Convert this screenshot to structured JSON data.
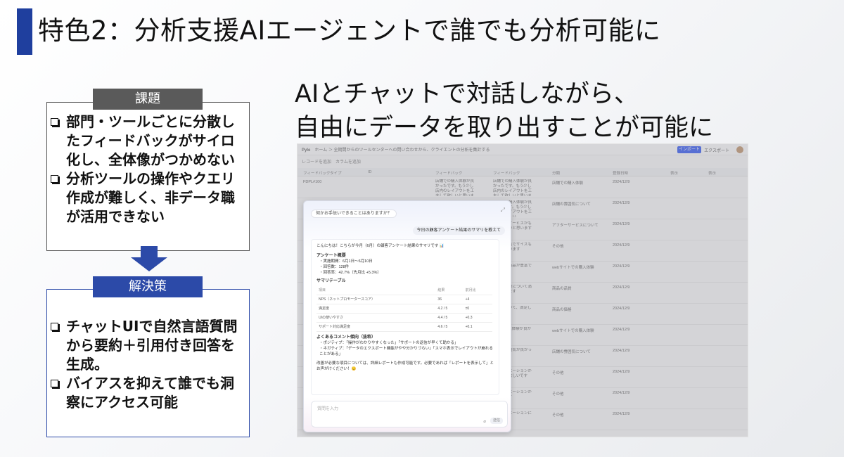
{
  "slide": {
    "title": "特色2：分析支援AIエージェントで誰でも分析可能に",
    "headline_line1": "AIとチャットで対話しながら、",
    "headline_line2": "自由にデータを取り出すことが可能に"
  },
  "problem": {
    "label": "課題",
    "items": [
      "部門・ツールごとに分散したフィードバックがサイロ化し、全体像がつかめない",
      "分析ツールの操作やクエリ作成が難しく、非データ職が活用できない"
    ]
  },
  "solution": {
    "label": "解決策",
    "items": [
      "チャットUIで自然言語質問から要約＋引用付き回答を生成。",
      "バイアスを抑えて誰でも洞察にアクセス可能"
    ]
  },
  "screenshot": {
    "topbar": {
      "app": "Pyle",
      "crumb": "ホーム ＞ 全期間からのツールセンターへの問い合わせから、クライエントの分析を集計する",
      "import_label": "インポート",
      "export_label": "エクスポート"
    },
    "toolbar": "レコードを追加　カラムを追加",
    "table_headers": [
      "フィードバックタイプ",
      "ID",
      "フィードバック",
      "フィードバック",
      "分類",
      "登録日時",
      "表示",
      "表示"
    ],
    "rows": [
      {
        "id": "FDPL#100",
        "fb": "店舗での購入体験が良かったです。もう少し店内のレイアウトを工夫して欲しいと思います",
        "cat": "店舗での購入体験",
        "date": "2024/12/9"
      },
      {
        "id": "",
        "fb": "店舗での購入体験が良かったです。もう少し店内のレイアウトを工夫して欲しい",
        "cat": "店舗の雰囲気について",
        "date": "2024/12/9"
      },
      {
        "id": "",
        "fb": "アフターサービスがもう少し良いと思います",
        "cat": "アフターサービスについて",
        "date": "2024/12/9"
      },
      {
        "id": "",
        "fb": "商品が豊富でサイズも多いと思います",
        "cat": "その他",
        "date": "2024/12/9"
      },
      {
        "id": "",
        "fb": "サイズも商品が豊富です",
        "cat": "webサイトでの購入体験",
        "date": "2024/12/9"
      },
      {
        "id": "",
        "fb": "商品の品質について満足しています",
        "cat": "商品の品質",
        "date": "2024/12/9"
      },
      {
        "id": "",
        "fb": "価格について、満足しています",
        "cat": "商品の価格",
        "date": "2024/12/9"
      },
      {
        "id": "",
        "fb": "webで購入体験が良かったです",
        "cat": "webサイトでの購入体験",
        "date": "2024/12/9"
      },
      {
        "id": "",
        "fb": "店内の雰囲気が良かったです",
        "cat": "店舗の雰囲気について",
        "date": "2024/12/9"
      },
      {
        "id": "",
        "fb": "そのバリエーションがもう少し欲しいです",
        "cat": "その他",
        "date": "2024/12/9"
      },
      {
        "id": "",
        "fb": "そのバリエーションが少ないです",
        "cat": "その他",
        "date": "2024/12/9"
      },
      {
        "id": "",
        "fb": "そのバリエーションについて",
        "cat": "その他",
        "date": "2024/12/9"
      }
    ],
    "chat": {
      "greeting": "何かお手伝いできることはありますか？",
      "user_message": "今日の顧客アンケート結果のサマリを教えて",
      "answer_intro": "こんにちは！こちらが今月（6月）の顧客アンケート結果のサマリです 📊",
      "survey_heading": "アンケート概要",
      "survey_items": [
        "・実施期間：6月1日〜6月10日",
        "・回答数：128件",
        "・回答率：42.7%（先月比 +5.3%）"
      ],
      "summary_heading": "サマリテーブル",
      "table_headers": [
        "項目",
        "結果",
        "前月比"
      ],
      "table_rows": [
        [
          "NPS（ネットプロモータースコア）",
          "36",
          "+4"
        ],
        [
          "満足度",
          "4.2 / 5",
          "±0"
        ],
        [
          "UIの使いやすさ",
          "4.4 / 5",
          "+0.3"
        ],
        [
          "サポート対応満足度",
          "4.6 / 5",
          "+0.1"
        ]
      ],
      "comments_heading": "よくあるコメント傾向（抜粋）",
      "comments": [
        "・ポジティブ：「操作がわかりやすくなった」「サポートの返信が早くて助かる」",
        "・ネガティブ：「データのエクスポート機能がやや分かりづらい」「スマホ表示でレイアウトが崩れることがある」"
      ],
      "closing": "改善が必要な項目については、詳細レポートも作成可能です。必要であれば「レポートを表示して」とお声がけください！😊",
      "input_placeholder": "質問を入力",
      "send_label": "送信"
    }
  }
}
